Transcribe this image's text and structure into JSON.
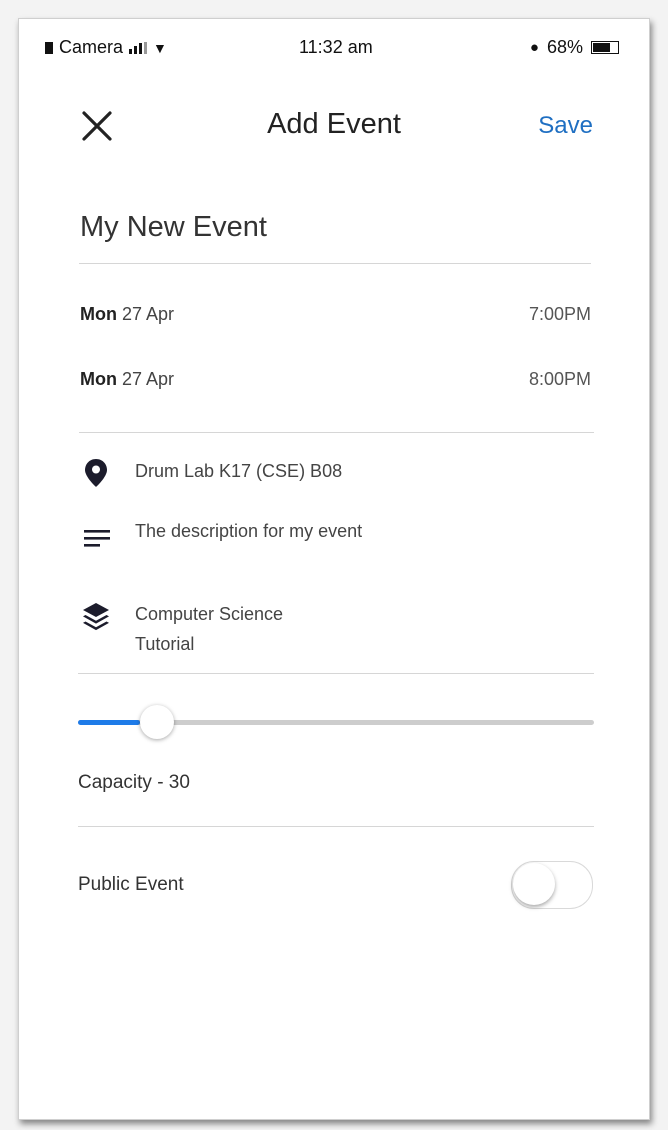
{
  "status_bar": {
    "carrier": "Camera",
    "time": "11:32 am",
    "battery": "68%"
  },
  "header": {
    "title": "Add Event",
    "save_label": "Save",
    "close_icon": "close-icon"
  },
  "event": {
    "name": "My New Event",
    "start": {
      "day": "Mon",
      "date": "27 Apr",
      "time": "7:00PM"
    },
    "end": {
      "day": "Mon",
      "date": "27 Apr",
      "time": "8:00PM"
    },
    "location": "Drum Lab K17 (CSE) B08",
    "description": "The description for my event",
    "category": {
      "line1": "Computer Science",
      "line2": "Tutorial"
    }
  },
  "capacity": {
    "label": "Capacity - 30",
    "slider_fraction": 0.12,
    "accent": "#1e7be8"
  },
  "public_event": {
    "label": "Public Event",
    "enabled": false
  },
  "colors": {
    "save": "#1f6fc2",
    "slider_fill": "#1e7be8",
    "divider": "#d6d6d6"
  },
  "icons": {
    "location": "location-pin-icon",
    "description": "notes-icon",
    "category": "layers-icon"
  }
}
